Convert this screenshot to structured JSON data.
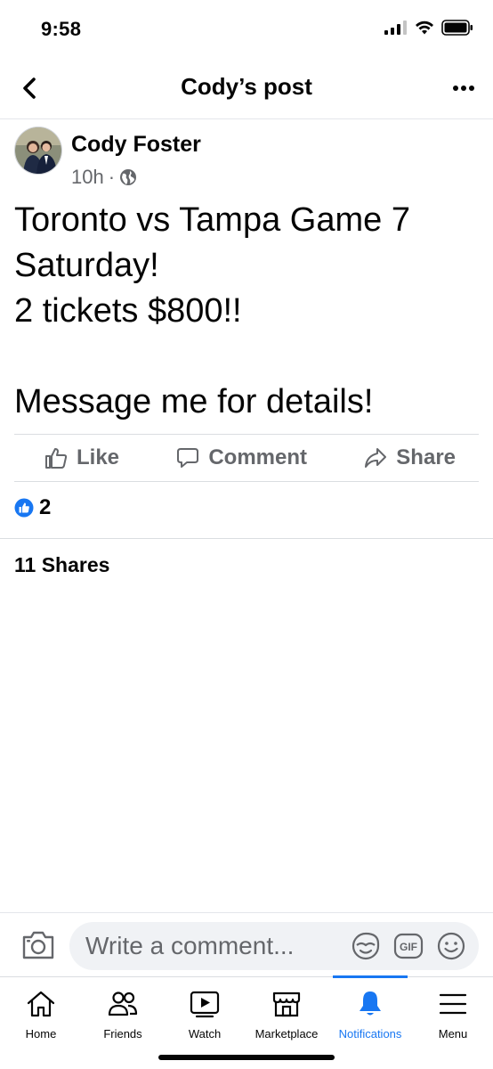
{
  "status_bar": {
    "time": "9:58"
  },
  "nav": {
    "title": "Cody’s post"
  },
  "post": {
    "author": "Cody Foster",
    "time": "10h",
    "separator": "·",
    "lines": [
      "Toronto vs Tampa Game 7",
      "Saturday!",
      "2 tickets $800!!",
      "",
      "Message me for details!"
    ]
  },
  "actions": {
    "like": "Like",
    "comment": "Comment",
    "share": "Share"
  },
  "reactions": {
    "count": "2"
  },
  "shares": {
    "text": "11 Shares"
  },
  "composer": {
    "placeholder": "Write a comment..."
  },
  "tabs": [
    {
      "label": "Home",
      "icon": "home-icon"
    },
    {
      "label": "Friends",
      "icon": "friends-icon"
    },
    {
      "label": "Watch",
      "icon": "watch-icon"
    },
    {
      "label": "Marketplace",
      "icon": "marketplace-icon"
    },
    {
      "label": "Notifications",
      "icon": "bell-icon",
      "active": true
    },
    {
      "label": "Menu",
      "icon": "menu-icon"
    }
  ],
  "colors": {
    "accent": "#1877f2",
    "secondary_text": "#65676b",
    "divider": "#dadde1"
  }
}
